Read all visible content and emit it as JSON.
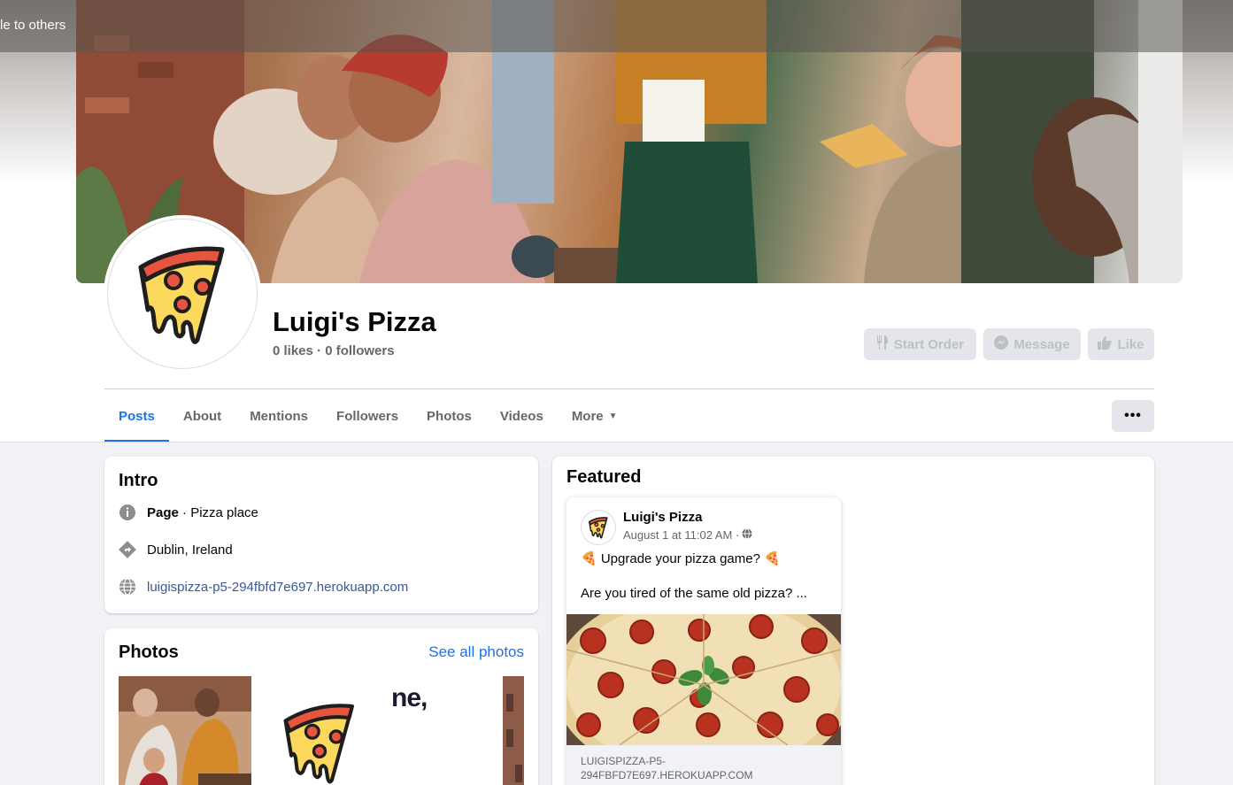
{
  "banner": {
    "text": "le to others"
  },
  "profile": {
    "name": "Luigi's Pizza",
    "stats": "0 likes · 0 followers"
  },
  "actions": {
    "start_order": "Start Order",
    "message": "Message",
    "like": "Like"
  },
  "tabs": [
    "Posts",
    "About",
    "Mentions",
    "Followers",
    "Photos",
    "Videos",
    "More"
  ],
  "more_menu": "•••",
  "intro": {
    "title": "Intro",
    "category_label": "Page",
    "category_value": " · Pizza place",
    "location": "Dublin, Ireland",
    "website": "luigispizza-p5-294fbfd7e697.herokuapp.com"
  },
  "photos": {
    "title": "Photos",
    "see_all": "See all photos",
    "thumb_text": "ne,"
  },
  "featured": {
    "title": "Featured",
    "post": {
      "author": "Luigi's Pizza",
      "date": "August 1 at 11:02 AM ·",
      "line1": "🍕 Upgrade your pizza game? 🍕",
      "line2": "Are you tired of the same old pizza? ...",
      "link": "LUIGISPIZZA-P5-294FBFD7E697.HEROKUAPP.COM"
    }
  },
  "colors": {
    "accent": "#1b74e4",
    "link": "#385898",
    "pizza_red": "#e8553f",
    "pizza_cheese": "#fcd85c"
  }
}
